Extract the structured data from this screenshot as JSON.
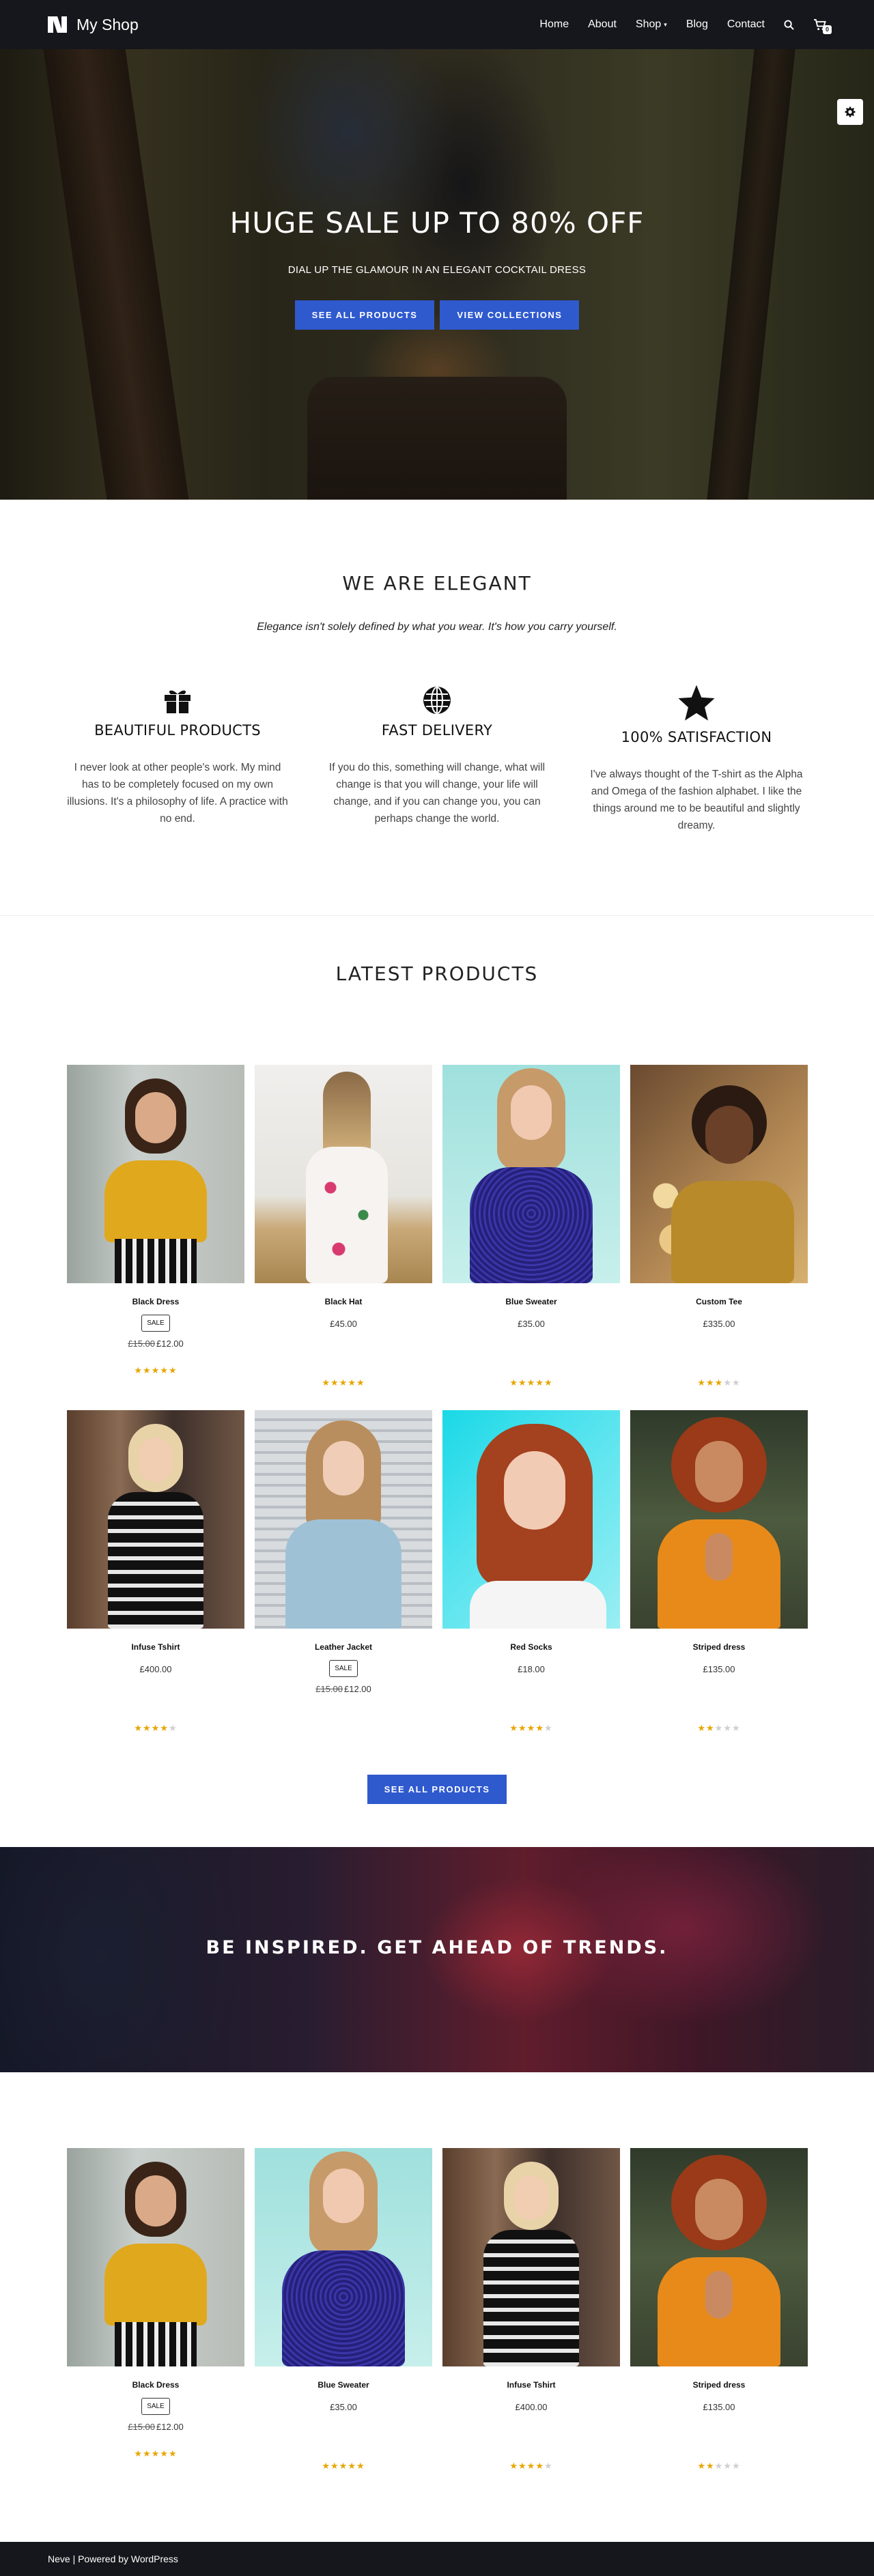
{
  "header": {
    "site_title": "My Shop",
    "nav": [
      {
        "label": "Home"
      },
      {
        "label": "About"
      },
      {
        "label": "Shop"
      },
      {
        "label": "Blog"
      },
      {
        "label": "Contact"
      }
    ],
    "cart_count": "0"
  },
  "hero": {
    "title": "HUGE SALE UP TO 80% OFF",
    "subtitle": "DIAL UP THE GLAMOUR IN AN ELEGANT COCKTAIL DRESS",
    "button_primary": "SEE ALL PRODUCTS",
    "button_secondary": "VIEW COLLECTIONS"
  },
  "elegant": {
    "title": "WE ARE ELEGANT",
    "subtitle": "Elegance isn't solely defined by what you wear. It's how you carry yourself.",
    "features": [
      {
        "icon": "gift-icon",
        "title": "BEAUTIFUL PRODUCTS",
        "text": "I never look at other people's work. My mind has to be completely focused on my own illusions. It's a philosophy of life. A practice with no end."
      },
      {
        "icon": "globe-icon",
        "title": "FAST DELIVERY",
        "text": "If you do this, something will change, what will change is that you will change, your life will change, and if you can change you, you can perhaps change the world."
      },
      {
        "icon": "star-icon",
        "title": "100% SATISFACTION",
        "text": "I've always thought of the T-shirt as the Alpha and Omega of the fashion alphabet. I like the things around me to be beautiful and slightly dreamy."
      }
    ]
  },
  "latest": {
    "title": "LATEST PRODUCTS",
    "products": [
      {
        "name": "Black Dress",
        "sale": "SALE",
        "old_price": "£15.00",
        "price": "£12.00",
        "rating": 5
      },
      {
        "name": "Black Hat",
        "price": "£45.00",
        "rating": 5
      },
      {
        "name": "Blue Sweater",
        "price": "£35.00",
        "rating": 5
      },
      {
        "name": "Custom Tee",
        "price": "£335.00",
        "rating": 3
      },
      {
        "name": "Infuse Tshirt",
        "price": "£400.00",
        "rating": 4
      },
      {
        "name": "Leather Jacket",
        "sale": "SALE",
        "old_price": "£15.00",
        "price": "£12.00",
        "rating": 0
      },
      {
        "name": "Red Socks",
        "price": "£18.00",
        "rating": 4
      },
      {
        "name": "Striped dress",
        "price": "£135.00",
        "rating": 2
      }
    ],
    "button": "SEE ALL PRODUCTS"
  },
  "banner": {
    "title": "BE INSPIRED. GET AHEAD OF TRENDS."
  },
  "featured": {
    "products": [
      {
        "name": "Black Dress",
        "sale": "SALE",
        "old_price": "£15.00",
        "price": "£12.00",
        "rating": 5
      },
      {
        "name": "Blue Sweater",
        "price": "£35.00",
        "rating": 5
      },
      {
        "name": "Infuse Tshirt",
        "price": "£400.00",
        "rating": 4
      },
      {
        "name": "Striped dress",
        "price": "£135.00",
        "rating": 2
      }
    ]
  },
  "footer": {
    "text": "Neve | Powered by WordPress"
  },
  "colors": {
    "header_bg": "#15171c",
    "accent": "#2f5ace",
    "star": "#e8a500"
  }
}
